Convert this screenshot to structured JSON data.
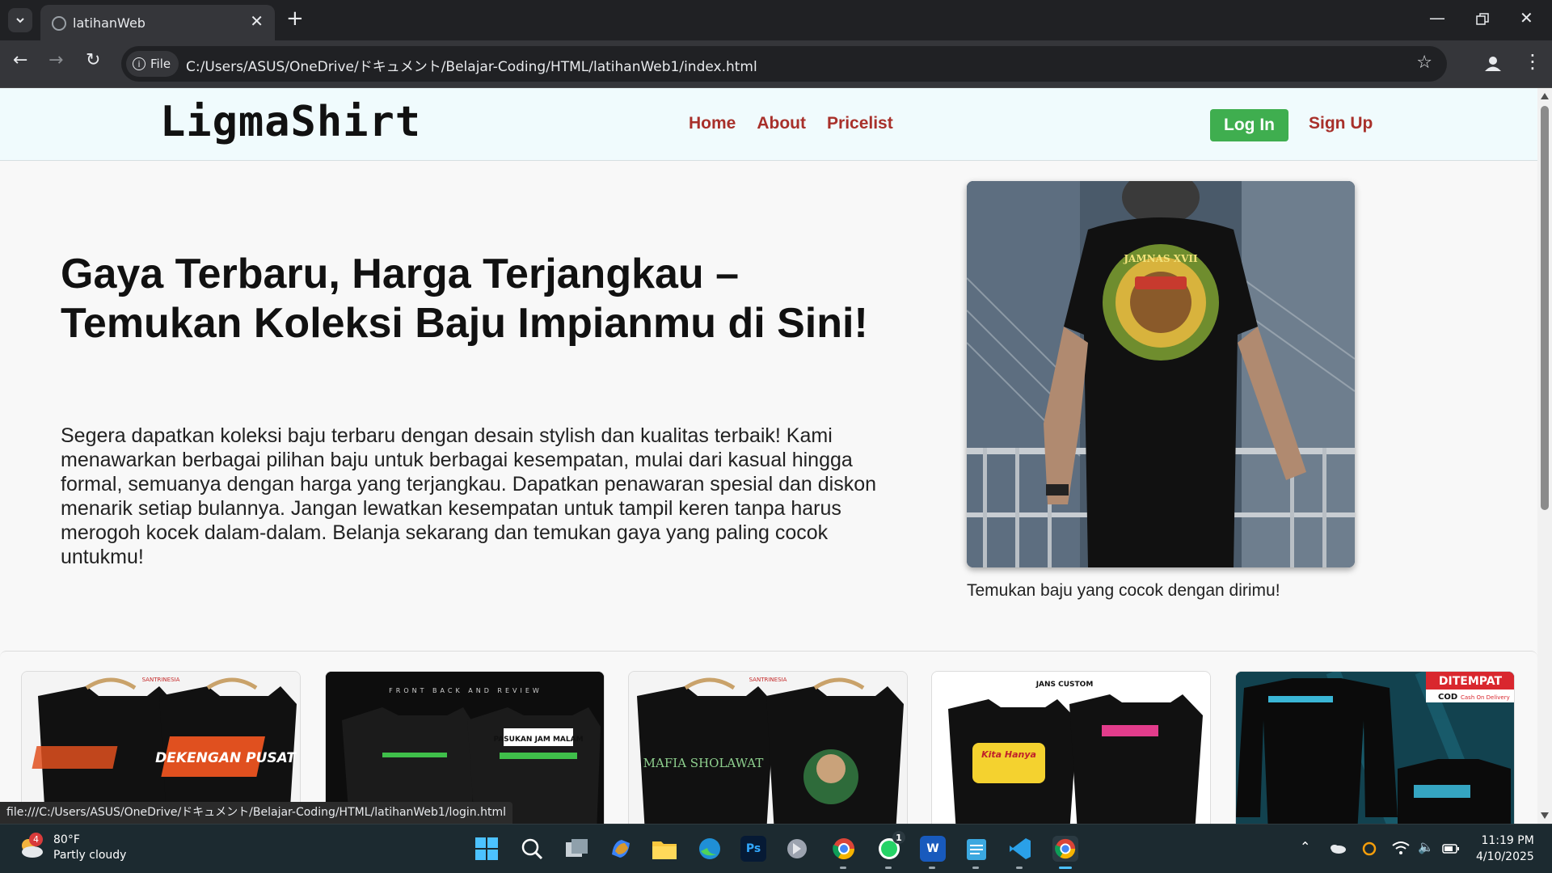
{
  "browser": {
    "tab_title": "latihanWeb",
    "url_chip": "File",
    "url": "C:/Users/ASUS/OneDrive/ドキュメント/Belajar-Coding/HTML/latihanWeb1/index.html",
    "status_url": "file:///C:/Users/ASUS/OneDrive/ドキュメント/Belajar-Coding/HTML/latihanWeb1/login.html"
  },
  "site": {
    "logo": "LigmaShirt",
    "nav": [
      "Home",
      "About",
      "Pricelist"
    ],
    "login_label": "Log In",
    "signup_label": "Sign Up"
  },
  "hero": {
    "title": "Gaya Terbaru, Harga Terjangkau – Temukan Koleksi Baju Impianmu di Sini!",
    "text": "Segera dapatkan koleksi baju terbaru dengan desain stylish dan kualitas terbaik! Kami menawarkan berbagai pilihan baju untuk berbagai kesempatan, mulai dari kasual hingga formal, semuanya dengan harga yang terjangkau. Dapatkan penawaran spesial dan diskon menarik setiap bulannya. Jangan lewatkan kesempatan untuk tampil keren tanpa harus merogoh kocek dalam-dalam. Belanja sekarang dan temukan gaya yang paling cocok untukmu!",
    "image_caption": "Temukan baju yang cocok dengan dirimu!",
    "shirt_print_text": "JAMNAS XVII"
  },
  "products": [
    {
      "brand": "SANTRINESIA",
      "print": "DEKENGAN PUSAT"
    },
    {
      "brand": "FRONT BACK AND REVIEW",
      "print": "PASUKAN JAM MALAM"
    },
    {
      "brand": "SANTRINESIA",
      "print": "MAFIA SHOLAWAT"
    },
    {
      "brand": "JANS CUSTOM",
      "print": "Kita Hanya"
    },
    {
      "brand": "DITEMPAT",
      "sub": "COD",
      "sub2": "Cash On Delivery"
    }
  ],
  "taskbar": {
    "weather_temp": "80°F",
    "weather_desc": "Partly cloudy",
    "weather_badge": "4",
    "time": "11:19 PM",
    "date": "4/10/2025",
    "whatsapp_badge": "1",
    "icons": [
      "start-icon",
      "search-icon",
      "task-view-icon",
      "copilot-icon",
      "file-explorer-icon",
      "edge-icon",
      "photoshop-icon",
      "app-icon",
      "chrome-profile-icon",
      "whatsapp-icon",
      "word-icon",
      "notepad-icon",
      "vscode-icon",
      "chrome-icon"
    ]
  },
  "colors": {
    "nav_link": "#a8302a",
    "login_button": "#3fae4f",
    "header_bg": "#f0fbfd",
    "page_bg": "#f8f8f8"
  }
}
